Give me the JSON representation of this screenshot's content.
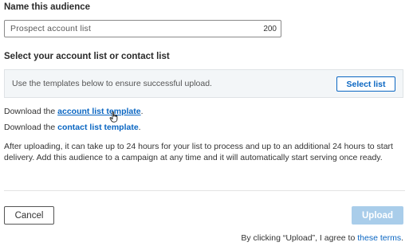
{
  "name_section": {
    "label": "Name this audience",
    "input_value": "Prospect account list",
    "char_count": "200"
  },
  "list_section": {
    "label": "Select your account list or contact list",
    "hint": "Use the templates below to ensure successful upload.",
    "select_button": "Select list"
  },
  "downloads": {
    "account_prefix": "Download the ",
    "account_link": "account list template",
    "account_suffix": ".",
    "contact_prefix": "Download the ",
    "contact_link": "contact list template",
    "contact_suffix": "."
  },
  "info": "After uploading, it can take up to 24 hours for your list to process and up to an additional 24 hours to start delivery. Add this audience to a campaign at any time and it will automatically start serving once ready.",
  "footer": {
    "cancel_label": "Cancel",
    "upload_label": "Upload",
    "terms_prefix": "By clicking “Upload”, I agree to ",
    "terms_link": "these terms",
    "terms_suffix": "."
  },
  "colors": {
    "link": "#0a66c2",
    "upload_disabled": "#a9cdea"
  },
  "icons": {
    "cursor": "hand-pointer-icon"
  }
}
